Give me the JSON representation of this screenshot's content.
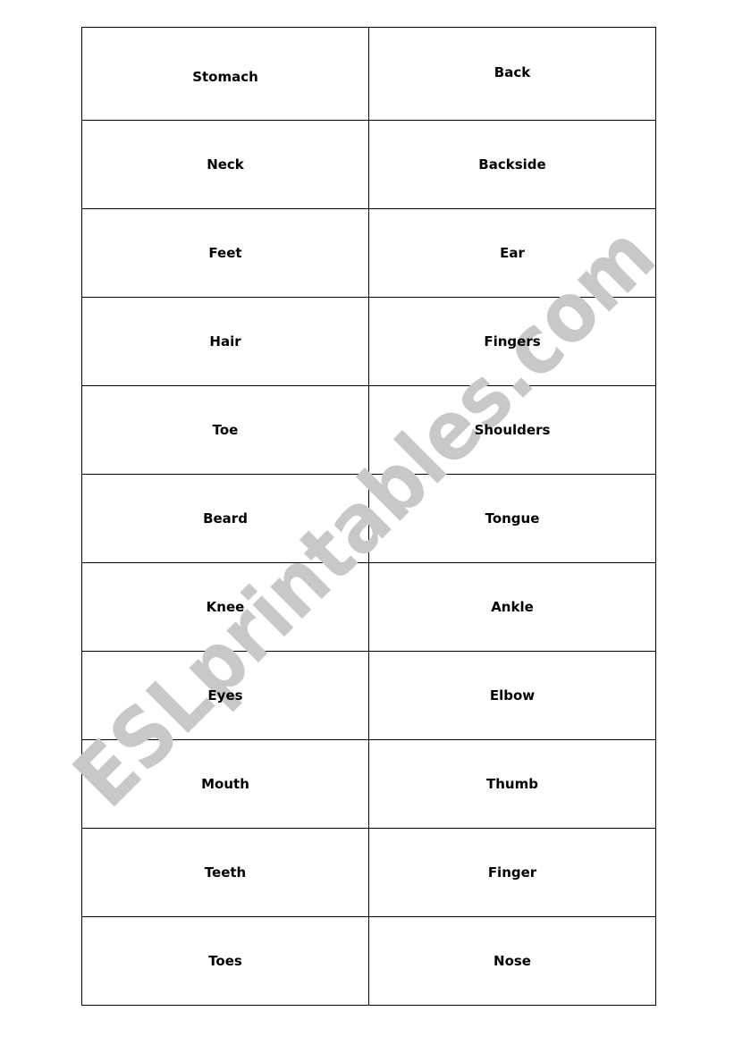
{
  "rows": [
    [
      "Stomach",
      "Back"
    ],
    [
      "Neck",
      "Backside"
    ],
    [
      "Feet",
      "Ear"
    ],
    [
      "Hair",
      "Fingers"
    ],
    [
      "Toe",
      "Shoulders"
    ],
    [
      "Beard",
      "Tongue"
    ],
    [
      "Knee",
      "Ankle"
    ],
    [
      "Eyes",
      "Elbow"
    ],
    [
      "Mouth",
      "Thumb"
    ],
    [
      "Teeth",
      "Finger"
    ],
    [
      "Toes",
      "Nose"
    ]
  ],
  "watermark": {
    "text": "ESLprintables.com",
    "color": "#c8c8c8"
  }
}
